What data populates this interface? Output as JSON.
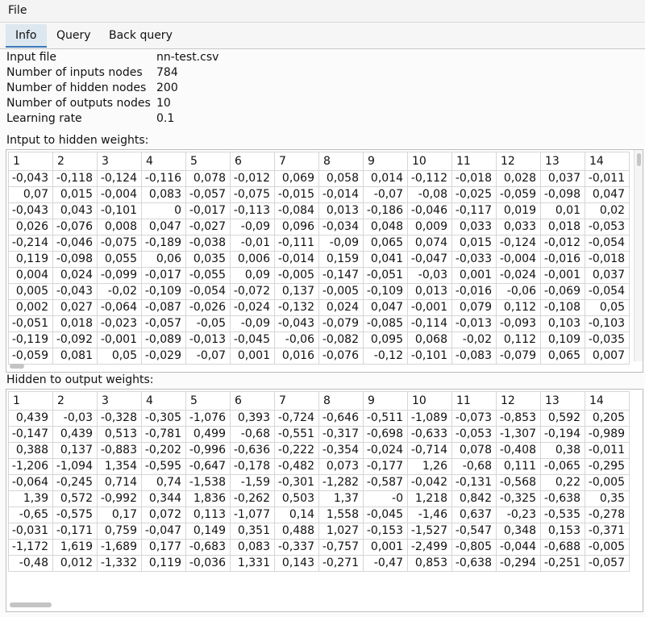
{
  "menu": {
    "file": "File"
  },
  "tabs": [
    "Info",
    "Query",
    "Back query"
  ],
  "info": [
    {
      "label": "Input file",
      "value": "nn-test.csv"
    },
    {
      "label": "Number of inputs nodes",
      "value": "784"
    },
    {
      "label": "Number of hidden nodes",
      "value": "200"
    },
    {
      "label": "Number of outputs nodes",
      "value": "10"
    },
    {
      "label": "Learning rate",
      "value": "0.1"
    }
  ],
  "ih_title": "Intput to hidden weights:",
  "ho_title": "Hidden to output weights:",
  "columns": [
    "1",
    "2",
    "3",
    "4",
    "5",
    "6",
    "7",
    "8",
    "9",
    "10",
    "11",
    "12",
    "13",
    "14"
  ],
  "ih_rows": [
    [
      "-0,043",
      "-0,118",
      "-0,124",
      "-0,116",
      "0,078",
      "-0,012",
      "0,069",
      "0,058",
      "0,014",
      "-0,112",
      "-0,018",
      "0,028",
      "0,037",
      "-0,011"
    ],
    [
      "0,07",
      "0,015",
      "-0,004",
      "0,083",
      "-0,057",
      "-0,075",
      "-0,015",
      "-0,014",
      "-0,07",
      "-0,08",
      "-0,025",
      "-0,059",
      "-0,098",
      "0,047"
    ],
    [
      "-0,043",
      "0,043",
      "-0,101",
      "0",
      "-0,017",
      "-0,113",
      "-0,084",
      "0,013",
      "-0,186",
      "-0,046",
      "-0,117",
      "0,019",
      "0,01",
      "0,02"
    ],
    [
      "0,026",
      "-0,076",
      "0,008",
      "0,047",
      "-0,027",
      "-0,09",
      "0,096",
      "-0,034",
      "0,048",
      "0,009",
      "0,033",
      "0,033",
      "0,018",
      "-0,053"
    ],
    [
      "-0,214",
      "-0,046",
      "-0,075",
      "-0,189",
      "-0,038",
      "-0,01",
      "-0,111",
      "-0,09",
      "0,065",
      "0,074",
      "0,015",
      "-0,124",
      "-0,012",
      "-0,054"
    ],
    [
      "0,119",
      "-0,098",
      "0,055",
      "0,06",
      "0,035",
      "0,006",
      "-0,014",
      "0,159",
      "0,041",
      "-0,047",
      "-0,033",
      "-0,004",
      "-0,016",
      "-0,018"
    ],
    [
      "0,004",
      "0,024",
      "-0,099",
      "-0,017",
      "-0,055",
      "0,09",
      "-0,005",
      "-0,147",
      "-0,051",
      "-0,03",
      "0,001",
      "-0,024",
      "-0,001",
      "0,037"
    ],
    [
      "0,005",
      "-0,043",
      "-0,02",
      "-0,109",
      "-0,054",
      "-0,072",
      "0,137",
      "-0,005",
      "-0,109",
      "0,013",
      "-0,016",
      "-0,06",
      "-0,069",
      "-0,054"
    ],
    [
      "0,002",
      "0,027",
      "-0,064",
      "-0,087",
      "-0,026",
      "-0,024",
      "-0,132",
      "0,024",
      "0,047",
      "-0,001",
      "0,079",
      "0,112",
      "-0,108",
      "0,05"
    ],
    [
      "-0,051",
      "0,018",
      "-0,023",
      "-0,057",
      "-0,05",
      "-0,09",
      "-0,043",
      "-0,079",
      "-0,085",
      "-0,114",
      "-0,013",
      "-0,093",
      "0,103",
      "-0,103"
    ],
    [
      "-0,119",
      "-0,092",
      "-0,001",
      "-0,089",
      "-0,013",
      "-0,045",
      "-0,06",
      "-0,082",
      "0,095",
      "0,068",
      "-0,02",
      "0,112",
      "0,109",
      "-0,035"
    ],
    [
      "-0,059",
      "0,081",
      "0,05",
      "-0,029",
      "-0,07",
      "0,001",
      "0,016",
      "-0,076",
      "-0,12",
      "-0,101",
      "-0,083",
      "-0,079",
      "0,065",
      "0,007"
    ]
  ],
  "ho_rows": [
    [
      "0,439",
      "-0,03",
      "-0,328",
      "-0,305",
      "-1,076",
      "0,393",
      "-0,724",
      "-0,646",
      "-0,511",
      "-1,089",
      "-0,073",
      "-0,853",
      "0,592",
      "0,205"
    ],
    [
      "-0,147",
      "0,439",
      "0,513",
      "-0,781",
      "0,499",
      "-0,68",
      "-0,551",
      "-0,317",
      "-0,698",
      "-0,633",
      "-0,053",
      "-1,307",
      "-0,194",
      "-0,989"
    ],
    [
      "0,388",
      "0,137",
      "-0,883",
      "-0,202",
      "-0,996",
      "-0,636",
      "-0,222",
      "-0,354",
      "-0,024",
      "-0,714",
      "0,078",
      "-0,408",
      "0,38",
      "-0,011"
    ],
    [
      "-1,206",
      "-1,094",
      "1,354",
      "-0,595",
      "-0,647",
      "-0,178",
      "-0,482",
      "0,073",
      "-0,177",
      "1,26",
      "-0,68",
      "0,111",
      "-0,065",
      "-0,295"
    ],
    [
      "-0,064",
      "-0,245",
      "0,714",
      "0,74",
      "-1,538",
      "-1,59",
      "-0,301",
      "-1,282",
      "-0,587",
      "-0,042",
      "-0,131",
      "-0,568",
      "0,22",
      "-0,005"
    ],
    [
      "1,39",
      "0,572",
      "-0,992",
      "0,344",
      "1,836",
      "-0,262",
      "0,503",
      "1,37",
      "-0",
      "1,218",
      "0,842",
      "-0,325",
      "-0,638",
      "0,35"
    ],
    [
      "-0,65",
      "-0,575",
      "0,17",
      "0,072",
      "0,113",
      "-1,077",
      "0,14",
      "1,558",
      "-0,045",
      "-1,46",
      "0,637",
      "-0,23",
      "-0,535",
      "-0,278"
    ],
    [
      "-0,031",
      "-0,171",
      "0,759",
      "-0,047",
      "0,149",
      "0,351",
      "0,488",
      "1,027",
      "-0,153",
      "-1,527",
      "-0,547",
      "0,348",
      "0,153",
      "-0,371"
    ],
    [
      "-1,172",
      "1,619",
      "-1,689",
      "0,177",
      "-0,683",
      "0,083",
      "-0,337",
      "-0,757",
      "0,001",
      "-2,499",
      "-0,805",
      "-0,044",
      "-0,688",
      "-0,005"
    ],
    [
      "-0,48",
      "0,012",
      "-1,332",
      "0,119",
      "-0,036",
      "1,331",
      "0,143",
      "-0,271",
      "-0,47",
      "0,853",
      "-0,638",
      "-0,294",
      "-0,251",
      "-0,057"
    ]
  ]
}
